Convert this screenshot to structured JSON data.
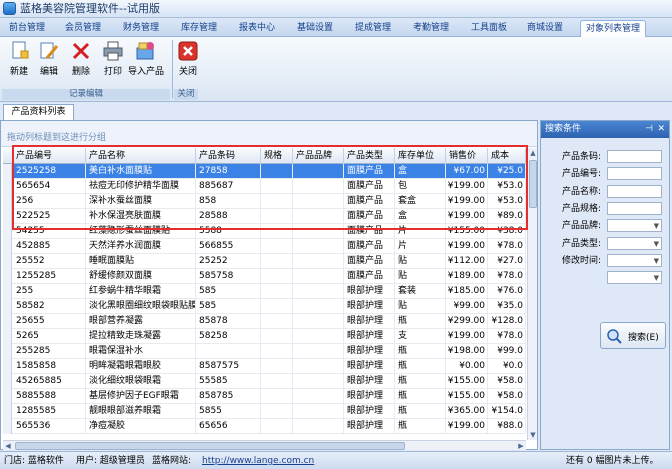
{
  "window": {
    "title": "蓝格美容院管理软件--试用版"
  },
  "menu": {
    "tabs": [
      {
        "label": "前台管理"
      },
      {
        "label": "会员管理"
      },
      {
        "label": "财务管理"
      },
      {
        "label": "库存管理"
      },
      {
        "label": "报表中心"
      },
      {
        "label": "基础设置"
      },
      {
        "label": "提成管理"
      },
      {
        "label": "考勤管理"
      },
      {
        "label": "工具面板"
      },
      {
        "label": "商城设置"
      },
      {
        "label": "对象列表管理"
      }
    ]
  },
  "ribbon": {
    "buttons": [
      {
        "label": "新建",
        "icon": "new-icon"
      },
      {
        "label": "编辑",
        "icon": "edit-icon"
      },
      {
        "label": "删除",
        "icon": "delete-icon"
      },
      {
        "label": "打印",
        "icon": "print-icon"
      },
      {
        "label": "导入产品",
        "icon": "import-icon"
      },
      {
        "label": "关闭",
        "icon": "close-icon"
      }
    ],
    "groups": [
      {
        "label": "记录编辑"
      },
      {
        "label": "关闭"
      }
    ]
  },
  "doc_tab": {
    "label": "产品资料列表"
  },
  "group_hint": "拖动列标题到这进行分组",
  "grid": {
    "columns": [
      "产品编号",
      "产品名称",
      "产品条码",
      "规格",
      "产品品牌",
      "产品类型",
      "库存单位",
      "销售价",
      "成本"
    ],
    "rows": [
      [
        "2525258",
        "美白补水面膜贴",
        "27858",
        "",
        "",
        "面膜产品",
        "盒",
        "¥67.00",
        "¥25.0"
      ],
      [
        "565654",
        "祛痘无印修护精华面膜",
        "885687",
        "",
        "",
        "面膜产品",
        "包",
        "¥199.00",
        "¥53.0"
      ],
      [
        "256",
        "深补水蚕丝面膜",
        "858",
        "",
        "",
        "面膜产品",
        "套盒",
        "¥199.00",
        "¥53.0"
      ],
      [
        "522525",
        "补水保湿亮肤面膜",
        "28588",
        "",
        "",
        "面膜产品",
        "盒",
        "¥199.00",
        "¥89.0"
      ],
      [
        "54255",
        "红藻隐形蚕丝面膜贴",
        "5588",
        "",
        "",
        "面膜产品",
        "片",
        "¥155.00",
        "¥38.0"
      ],
      [
        "452885",
        "天然洋养水润面膜",
        "566855",
        "",
        "",
        "面膜产品",
        "片",
        "¥199.00",
        "¥78.0"
      ],
      [
        "25552",
        "睡眠面膜贴",
        "25252",
        "",
        "",
        "面膜产品",
        "贴",
        "¥112.00",
        "¥27.0"
      ],
      [
        "1255285",
        "舒缓修颜双面膜",
        "585758",
        "",
        "",
        "面膜产品",
        "贴",
        "¥189.00",
        "¥78.0"
      ],
      [
        "255",
        "红参蜗牛精华眼霜",
        "585",
        "",
        "",
        "眼部护理",
        "套装",
        "¥185.00",
        "¥76.0"
      ],
      [
        "58582",
        "淡化黑眼圈细纹眼袋眼贴膜",
        "585",
        "",
        "",
        "眼部护理",
        "贴",
        "¥99.00",
        "¥35.0"
      ],
      [
        "25655",
        "眼部营养凝露",
        "85878",
        "",
        "",
        "眼部护理",
        "瓶",
        "¥299.00",
        "¥128.0"
      ],
      [
        "5265",
        "提拉精致走珠凝露",
        "58258",
        "",
        "",
        "眼部护理",
        "支",
        "¥199.00",
        "¥78.0"
      ],
      [
        "255285",
        "眼霜保湿补水",
        "",
        "",
        "",
        "眼部护理",
        "瓶",
        "¥198.00",
        "¥99.0"
      ],
      [
        "1585858",
        "明眸凝霜眼霜眼胶",
        "8587575",
        "",
        "",
        "眼部护理",
        "瓶",
        "¥0.00",
        "¥0.0"
      ],
      [
        "45265885",
        "淡化细纹眼袋眼霜",
        "55585",
        "",
        "",
        "眼部护理",
        "瓶",
        "¥155.00",
        "¥58.0"
      ],
      [
        "5885588",
        "基层修护因子EGF眼霜",
        "858785",
        "",
        "",
        "眼部护理",
        "瓶",
        "¥155.00",
        "¥58.0"
      ],
      [
        "1285585",
        "靓眼眼部滋养眼霜",
        "5855",
        "",
        "",
        "眼部护理",
        "瓶",
        "¥365.00",
        "¥154.0"
      ],
      [
        "565536",
        "净痘凝胶",
        "65656",
        "",
        "",
        "眼部护理",
        "瓶",
        "¥199.00",
        "¥88.0"
      ]
    ]
  },
  "search_panel": {
    "title": "搜索条件",
    "fields": [
      {
        "label": "产品条码:",
        "type": "text"
      },
      {
        "label": "产品编号:",
        "type": "text"
      },
      {
        "label": "产品名称:",
        "type": "text"
      },
      {
        "label": "产品规格:",
        "type": "text"
      },
      {
        "label": "产品品牌:",
        "type": "select"
      },
      {
        "label": "产品类型:",
        "type": "select"
      },
      {
        "label": "修改时间:",
        "type": "select"
      },
      {
        "label": "",
        "type": "select"
      }
    ],
    "search_button": "搜索(E)"
  },
  "status_bar": {
    "store_label": "门店: 蓝格软件",
    "user_label": "用户: 超级管理员",
    "site_label": "蓝格网站:",
    "site_url": "http://www.lange.com.cn",
    "right_text": "还有 0 幅图片未上传。"
  },
  "colors": {
    "selection": "#3b82e7",
    "highlight_box": "#e52d2d",
    "panel_header": "#2d62b0"
  }
}
